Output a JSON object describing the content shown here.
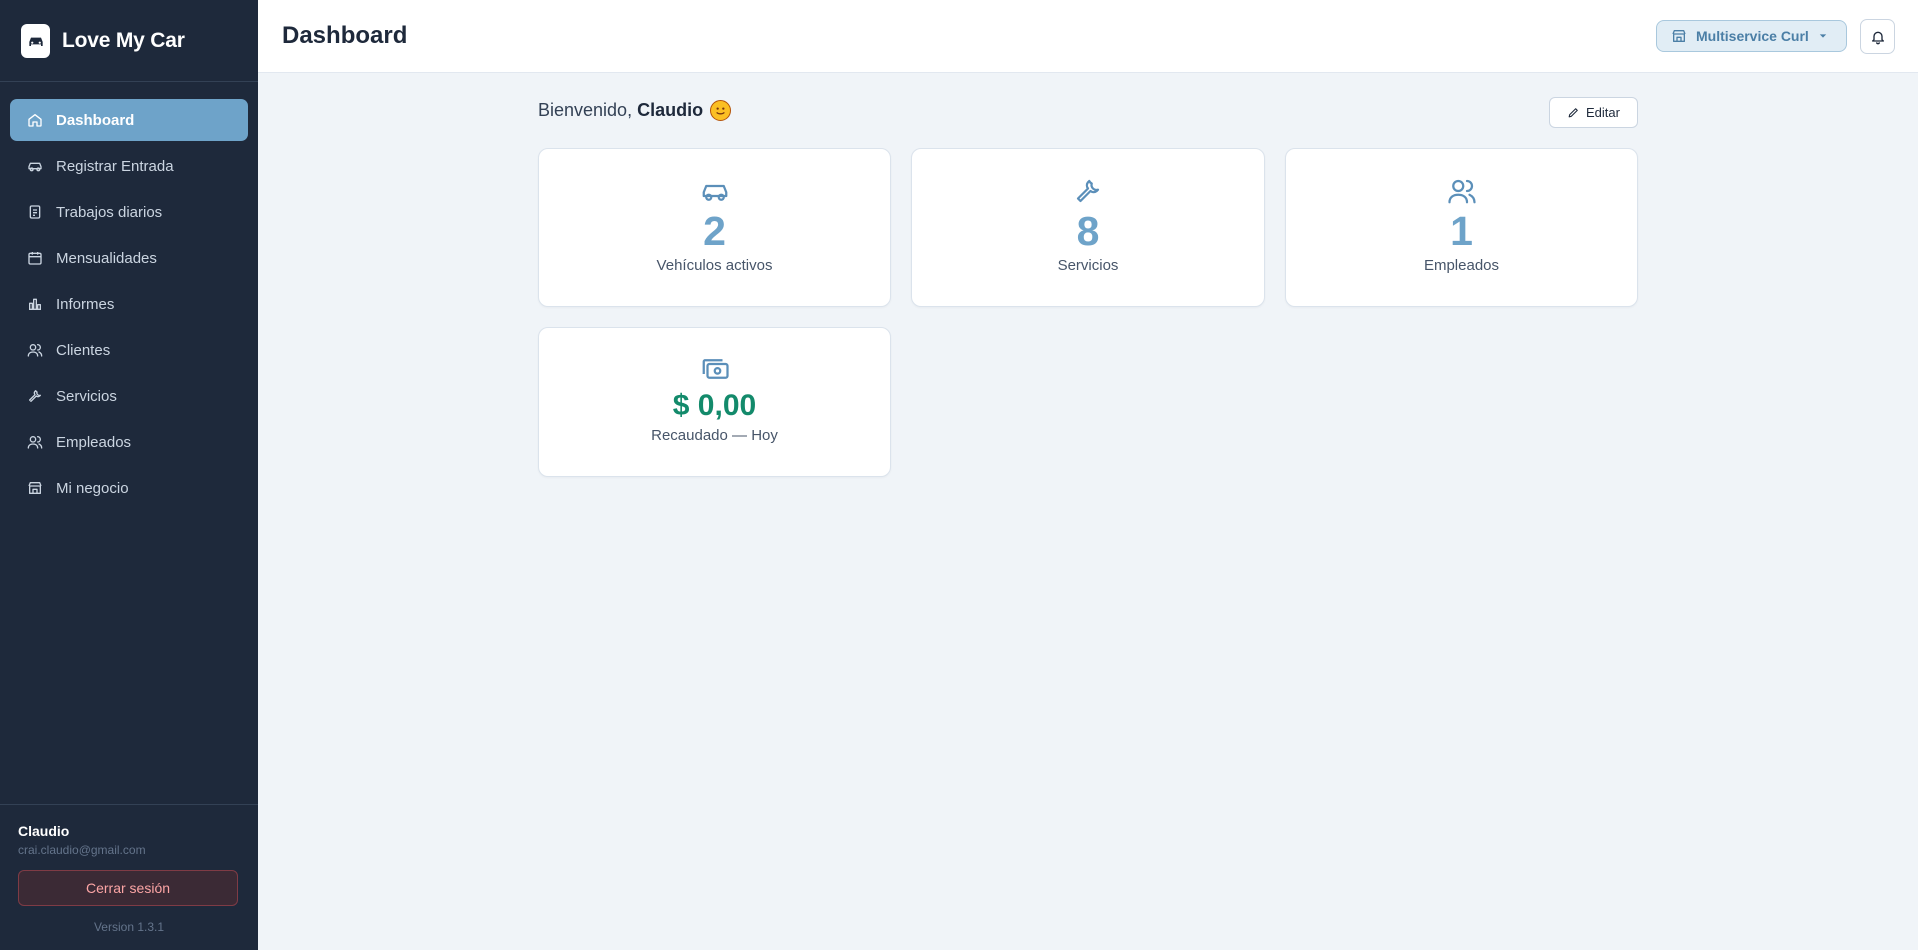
{
  "app": {
    "brand_name": "Love My Car"
  },
  "sidebar": {
    "items": [
      {
        "label": "Dashboard",
        "icon": "home-icon",
        "active": true
      },
      {
        "label": "Registrar Entrada",
        "icon": "car-icon"
      },
      {
        "label": "Trabajos diarios",
        "icon": "clipboard-icon"
      },
      {
        "label": "Mensualidades",
        "icon": "calendar-icon"
      },
      {
        "label": "Informes",
        "icon": "bar-chart-icon"
      },
      {
        "label": "Clientes",
        "icon": "users-icon"
      },
      {
        "label": "Servicios",
        "icon": "wrench-icon"
      },
      {
        "label": "Empleados",
        "icon": "users-icon"
      },
      {
        "label": "Mi negocio",
        "icon": "store-icon"
      }
    ],
    "footer": {
      "user_name": "Claudio",
      "user_email": "crai.claudio@gmail.com",
      "logout_label": "Cerrar sesión",
      "version": "Version 1.3.1"
    }
  },
  "header": {
    "title": "Dashboard",
    "business_selector": "Multiservice Curl"
  },
  "main": {
    "welcome_prefix": "Bienvenido,",
    "welcome_name": "Claudio",
    "edit_label": "Editar",
    "cards": [
      {
        "value": "2",
        "label": "Vehículos activos",
        "icon": "car-icon"
      },
      {
        "value": "8",
        "label": "Servicios",
        "icon": "wrench-icon"
      },
      {
        "value": "1",
        "label": "Empleados",
        "icon": "users-icon"
      },
      {
        "value": "$ 0,00",
        "label": "Recaudado — Hoy",
        "icon": "cash-icon"
      }
    ]
  },
  "colors": {
    "sidebar_bg": "#1e293b",
    "accent": "#6ea3c9",
    "money": "#138a6b",
    "page_bg": "#f0f4f8"
  }
}
